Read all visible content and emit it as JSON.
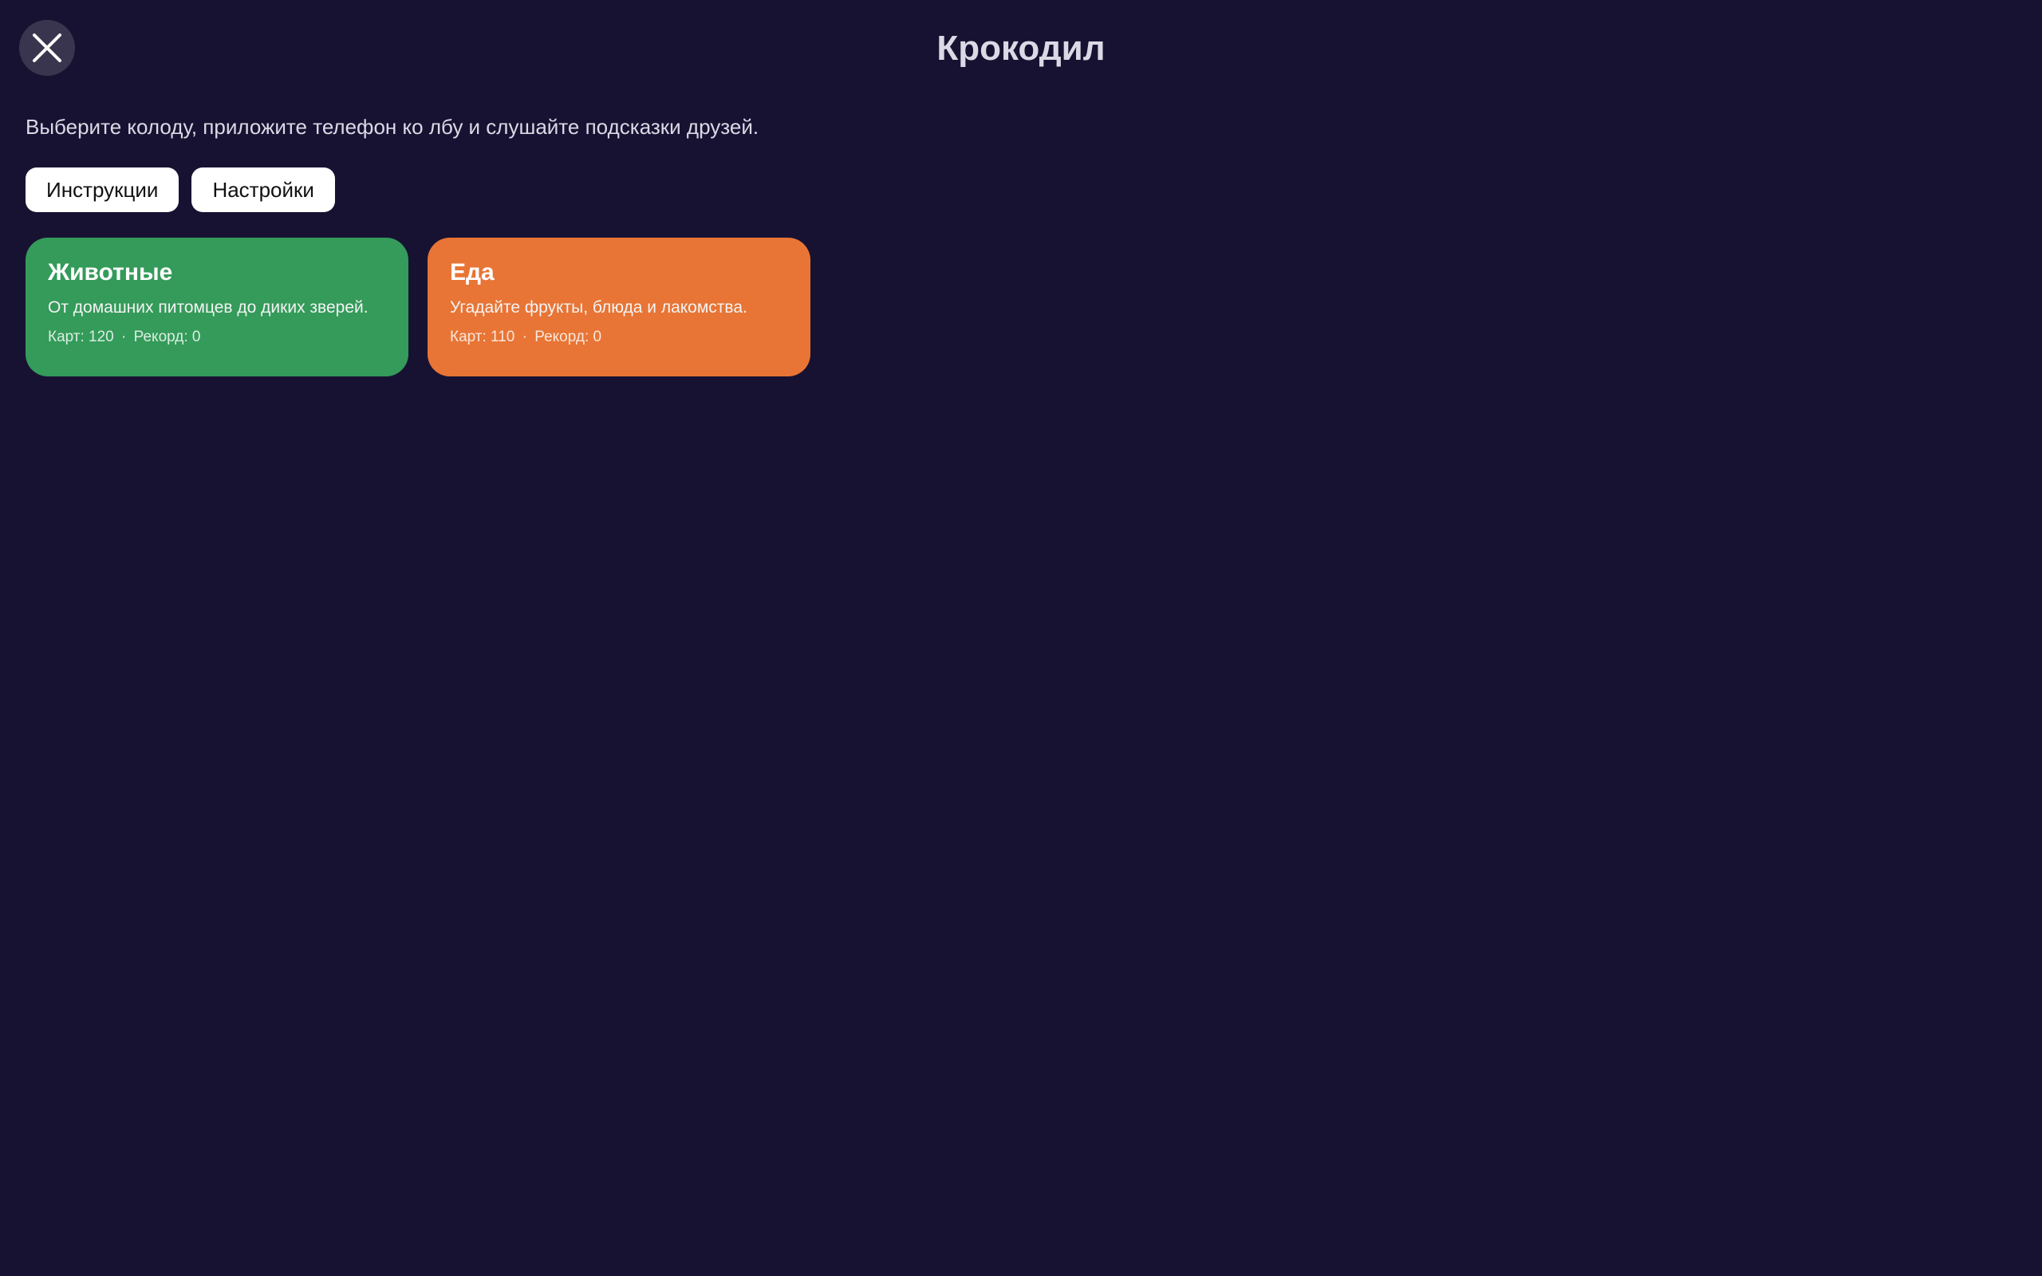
{
  "header": {
    "title": "Крокодил",
    "close_icon": "close-icon"
  },
  "intro": {
    "text": "Выберите колоду, приложите телефон ко лбу и слушайте подсказки друзей."
  },
  "actions": {
    "instructions_label": "Инструкции",
    "settings_label": "Настройки"
  },
  "decks": [
    {
      "name": "Животные",
      "description": "От домашних питомцев до диких зверей.",
      "cards_label": "Карт: 120",
      "separator": "·",
      "record_label": "Рекорд: 0",
      "color": "#349b5a"
    },
    {
      "name": "Еда",
      "description": "Угадайте фрукты, блюда и лакомства.",
      "cards_label": "Карт: 110",
      "separator": "·",
      "record_label": "Рекорд: 0",
      "color": "#e87535"
    }
  ]
}
